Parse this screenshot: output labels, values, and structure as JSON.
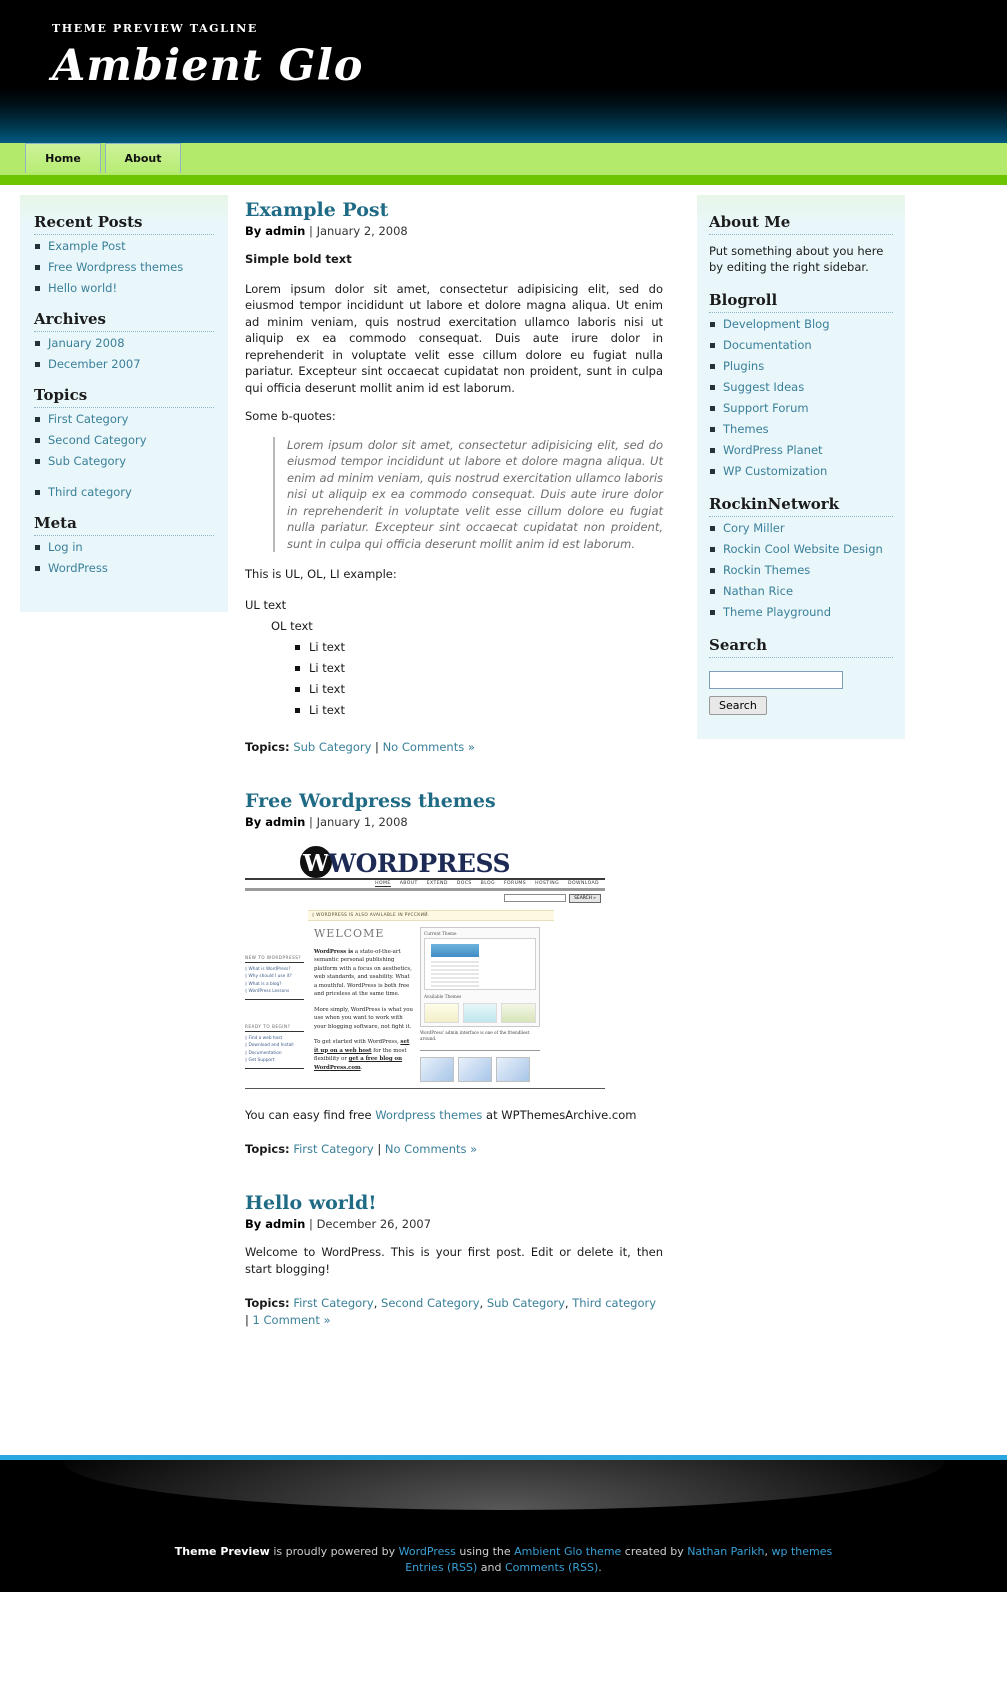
{
  "header": {
    "tagline": "THEME PREVIEW TAGLINE",
    "site_title": "Ambient Glo",
    "nav": [
      {
        "label": "Home"
      },
      {
        "label": "About"
      }
    ]
  },
  "sidebar_left": {
    "widgets": [
      {
        "title": "Recent Posts",
        "items": [
          {
            "label": "Example Post"
          },
          {
            "label": "Free Wordpress themes"
          },
          {
            "label": "Hello world!"
          }
        ]
      },
      {
        "title": "Archives",
        "items": [
          {
            "label": "January 2008"
          },
          {
            "label": "December 2007"
          }
        ]
      },
      {
        "title": "Topics",
        "items": [
          {
            "label": "First Category"
          },
          {
            "label": "Second Category"
          },
          {
            "label": "Sub Category"
          },
          {
            "label": "Third category"
          }
        ]
      },
      {
        "title": "Meta",
        "items": [
          {
            "label": "Log in"
          },
          {
            "label": "WordPress"
          }
        ]
      }
    ]
  },
  "posts": [
    {
      "title": "Example Post",
      "by_label": "By admin",
      "separator": "|",
      "date": "January 2, 2008",
      "bold_line": "Simple bold text",
      "paragraph": "Lorem ipsum dolor sit amet, consectetur adipisicing elit, sed do eiusmod tempor incididunt ut labore et dolore magna aliqua. Ut enim ad minim veniam, quis nostrud exercitation ullamco laboris nisi ut aliquip ex ea commodo consequat. Duis aute irure dolor in reprehenderit in voluptate velit esse cillum dolore eu fugiat nulla pariatur. Excepteur sint occaecat cupidatat non proident, sunt in culpa qui officia deserunt mollit anim id est laborum.",
      "quote_intro": "Some b-quotes:",
      "blockquote": "Lorem ipsum dolor sit amet, consectetur adipisicing elit, sed do eiusmod tempor incididunt ut labore et dolore magna aliqua. Ut enim ad minim veniam, quis nostrud exercitation ullamco laboris nisi ut aliquip ex ea commodo consequat. Duis aute irure dolor in reprehenderit in voluptate velit esse cillum dolore eu fugiat nulla pariatur. Excepteur sint occaecat cupidatat non proident, sunt in culpa qui officia deserunt mollit anim id est laborum.",
      "list_intro": "This is UL, OL, LI example:",
      "ul_text": "UL text",
      "ol_text": "OL text",
      "li_items": [
        "Li text",
        "Li text",
        "Li text",
        "Li text"
      ],
      "topics_label": "Topics:",
      "topics": [
        "Sub Category"
      ],
      "comments": "No Comments »"
    },
    {
      "title": "Free Wordpress themes",
      "by_label": "By admin",
      "separator": "|",
      "date": "January 1, 2008",
      "text_before_link": "You can easy find free ",
      "link_text": "Wordpress themes",
      "text_after_link": " at WPThemesArchive.com",
      "topics_label": "Topics:",
      "topics": [
        "First Category"
      ],
      "comments": "No Comments »"
    },
    {
      "title": "Hello world!",
      "by_label": "By admin",
      "separator": "|",
      "date": "December 26, 2007",
      "paragraph": "Welcome to WordPress. This is your first post. Edit or delete it, then start blogging!",
      "topics_label": "Topics:",
      "topics": [
        "First Category",
        "Second Category",
        "Sub Category",
        "Third category"
      ],
      "comments": "1 Comment »"
    }
  ],
  "wp_screenshot": {
    "wordmark_w": "W",
    "wordmark_text": "ORD",
    "wordmark_text2": "RESS",
    "wordmark_p": "P",
    "nav": [
      "HOME",
      "ABOUT",
      "EXTEND",
      "DOCS",
      "BLOG",
      "FORUMS",
      "HOSTING",
      "DOWNLOAD"
    ],
    "search_button": "SEARCH »",
    "notice": "◊ WORDPRESS IS ALSO AVAILABLE IN РУССКИЙ.",
    "welcome": "WELCOME",
    "para1_bold": "WordPress is",
    "para1": " a state-of-the-art semantic personal publishing platform with a focus on aesthetics, web standards, and usability. What a mouthful. WordPress is both free and priceless at the same time.",
    "para2": "More simply, WordPress is what you use when you want to work with your blogging software, not fight it.",
    "para3_pre": "To get started with WordPress, ",
    "para3_link1": "set it up on a web host",
    "para3_mid": " for the most flexibility or ",
    "para3_link2": "get a free blog on WordPress.com",
    "para3_end": ".",
    "side1_title": "NEW TO WORDPRESS?",
    "side1_items": [
      "◊ What is WordPress?",
      "◊ Why should I use it?",
      "◊ What is a blog?",
      "◊ WordPress Lessons"
    ],
    "side2_title": "READY TO BEGIN?",
    "side2_items": [
      "◊ Find a web host",
      "◊ Download and Install",
      "◊ Documentation",
      "◊ Get Support"
    ],
    "panel_title": "Current Theme",
    "panel2_title": "Available Themes",
    "panel_note": "WordPress' admin interface is one of the friendliest around."
  },
  "sidebar_right": {
    "about": {
      "title": "About Me",
      "text": "Put something about you here by editing the right sidebar."
    },
    "blogroll": {
      "title": "Blogroll",
      "items": [
        {
          "label": "Development Blog"
        },
        {
          "label": "Documentation"
        },
        {
          "label": "Plugins"
        },
        {
          "label": "Suggest Ideas"
        },
        {
          "label": "Support Forum"
        },
        {
          "label": "Themes"
        },
        {
          "label": "WordPress Planet"
        },
        {
          "label": "WP Customization"
        }
      ]
    },
    "rockin": {
      "title": "RockinNetwork",
      "items": [
        {
          "label": "Cory Miller"
        },
        {
          "label": "Rockin Cool Website Design"
        },
        {
          "label": "Rockin Themes"
        },
        {
          "label": "Nathan Rice"
        },
        {
          "label": "Theme Playground"
        }
      ]
    },
    "search": {
      "title": "Search",
      "value": "",
      "placeholder": "",
      "button_label": "Search"
    }
  },
  "footer": {
    "site_name": "Theme Preview",
    "powered_by": " is proudly powered by ",
    "wordpress": "WordPress",
    "using": " using the ",
    "theme_link": "Ambient Glo theme",
    "created_by": " created by ",
    "author": "Nathan Parikh",
    "comma": ", ",
    "wp_themes": "wp themes",
    "entries": "Entries (RSS)",
    "and": " and ",
    "comments": "Comments (RSS)",
    "period": "."
  },
  "colors": {
    "accent_green": "#b3ea6b",
    "accent_green_dark": "#6dc400",
    "link_blue": "#3a7f99",
    "title_blue": "#1f6a85",
    "footer_blue": "#2aa7e0",
    "sidebar_bg": "#e9f7fb"
  }
}
